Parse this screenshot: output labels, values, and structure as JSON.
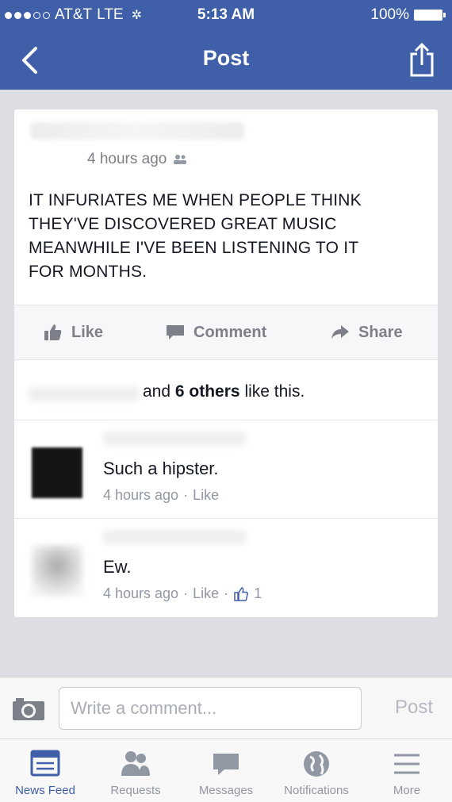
{
  "status_bar": {
    "carrier": "AT&T",
    "network": "LTE",
    "time": "5:13 AM",
    "battery": "100%"
  },
  "nav": {
    "title": "Post",
    "back_icon": "chevron-left-icon",
    "share_icon": "share-icon"
  },
  "post": {
    "timestamp": "4 hours ago",
    "audience_icon": "friends-icon",
    "text_lines": [
      "IT INFURIATES ME WHEN PEOPLE THINK",
      "THEY'VE DISCOVERED GREAT MUSIC",
      "MEANWHILE I'VE BEEN LISTENING TO IT",
      "FOR MONTHS."
    ]
  },
  "actions": {
    "like": "Like",
    "comment": "Comment",
    "share": "Share"
  },
  "likes": {
    "prefix": "and",
    "count_text": "6 others",
    "suffix": "like this."
  },
  "comments": [
    {
      "text": "Such a hipster.",
      "time": "4 hours ago",
      "like_label": "Like",
      "like_count": ""
    },
    {
      "text": "Ew.",
      "time": "4 hours ago",
      "like_label": "Like",
      "like_count": "1"
    }
  ],
  "composer": {
    "placeholder": "Write a comment...",
    "post_label": "Post"
  },
  "tabs": [
    {
      "label": "News Feed",
      "icon": "news-feed-icon",
      "active": true
    },
    {
      "label": "Requests",
      "icon": "friend-requests-icon",
      "active": false
    },
    {
      "label": "Messages",
      "icon": "messages-icon",
      "active": false
    },
    {
      "label": "Notifications",
      "icon": "globe-icon",
      "active": false
    },
    {
      "label": "More",
      "icon": "menu-icon",
      "active": false
    }
  ],
  "colors": {
    "brand_blue": "#3f5fa8",
    "background": "#dcdee3",
    "muted_text": "#9197a3"
  }
}
